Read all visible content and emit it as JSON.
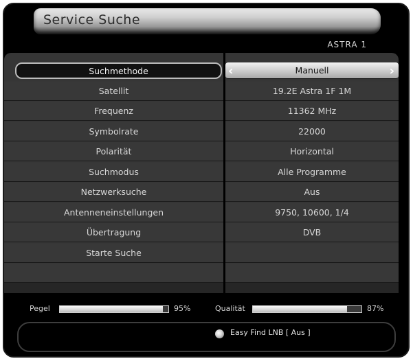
{
  "window": {
    "title": "Service Suche",
    "satellite": "ASTRA 1"
  },
  "rows": [
    {
      "label": "Suchmethode",
      "value": "Manuell"
    },
    {
      "label": "Satellit",
      "value": "19.2E Astra 1F 1M"
    },
    {
      "label": "Frequenz",
      "value": "11362 MHz"
    },
    {
      "label": "Symbolrate",
      "value": "22000"
    },
    {
      "label": "Polarität",
      "value": "Horizontal"
    },
    {
      "label": "Suchmodus",
      "value": "Alle Programme"
    },
    {
      "label": "Netzwerksuche",
      "value": "Aus"
    },
    {
      "label": "Antenneneinstellungen",
      "value": "9750, 10600, 1/4"
    },
    {
      "label": "Übertragung",
      "value": "DVB"
    },
    {
      "label": "Starte Suche",
      "value": ""
    }
  ],
  "status": {
    "pegel_label": "Pegel",
    "pegel_value": "95%",
    "pegel_fraction": 0.95,
    "qualitaet_label": "Qualität",
    "qualitaet_value": "87%",
    "qualitaet_fraction": 0.87,
    "easy_find": "Easy Find LNB [ Aus ]"
  },
  "icons": {
    "arrow_left": "chevron-left-icon",
    "arrow_right": "chevron-right-icon",
    "radio": "radio-icon"
  }
}
